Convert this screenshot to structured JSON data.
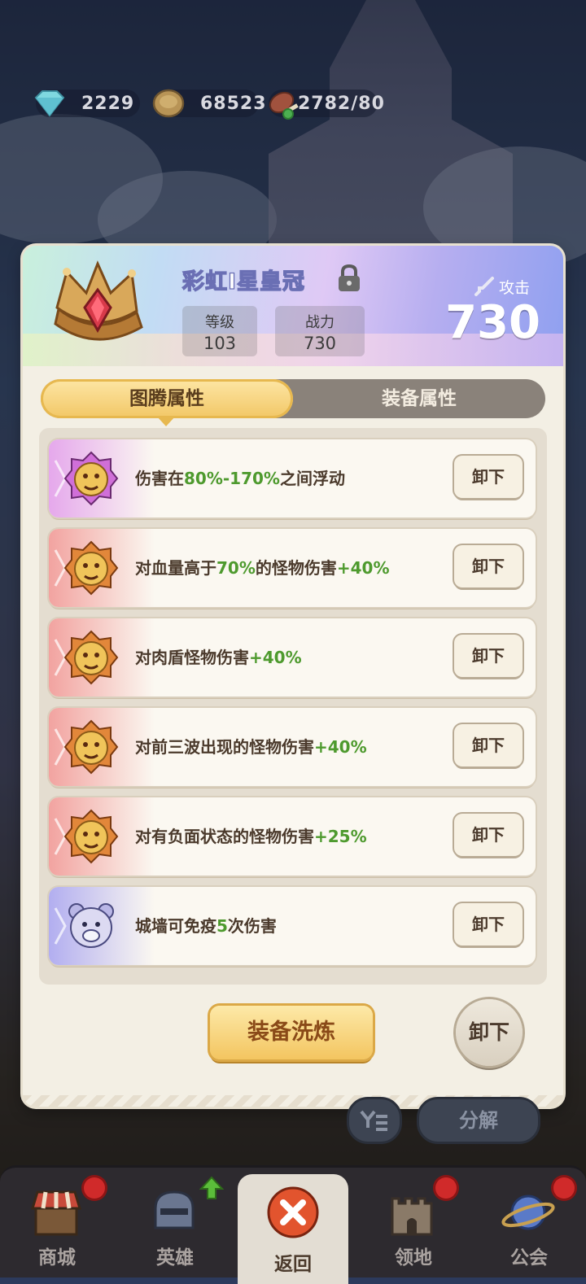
{
  "resources": [
    {
      "icon": "diamond-icon",
      "value": "2229"
    },
    {
      "icon": "coin-icon",
      "value": "68523"
    },
    {
      "icon": "meat-icon",
      "value": "2782/80"
    }
  ],
  "item": {
    "name": "彩虹I星皇冠",
    "level_label": "等级",
    "level": "103",
    "power_label": "战力",
    "power": "730",
    "attack_label": "攻击",
    "attack": "730"
  },
  "tabs": {
    "active": "图腾属性",
    "inactive": "装备属性"
  },
  "attributes": [
    {
      "tier": "purple",
      "prefix": "伤害在",
      "value": "80%-170%",
      "suffix": "之间浮动",
      "button": "卸下"
    },
    {
      "tier": "red",
      "prefix": "对血量高于",
      "value": "70%",
      "suffix": "的怪物伤害",
      "value2": "+40%",
      "button": "卸下"
    },
    {
      "tier": "red",
      "prefix": "对肉盾怪物伤害",
      "value": "+40%",
      "suffix": "",
      "button": "卸下"
    },
    {
      "tier": "red",
      "prefix": "对前三波出现的怪物伤害",
      "value": "+40%",
      "suffix": "",
      "button": "卸下"
    },
    {
      "tier": "red",
      "prefix": "对有负面状态的怪物伤害",
      "value": "+25%",
      "suffix": "",
      "button": "卸下"
    },
    {
      "tier": "blue",
      "prefix": "城墙可免疫",
      "value": "5",
      "suffix": "次伤害",
      "button": "卸下"
    }
  ],
  "actions": {
    "refine": "装备洗炼",
    "unequip": "卸下"
  },
  "under_panel": {
    "decompose": "分解"
  },
  "nav": [
    {
      "label": "商城",
      "icon": "shop-icon",
      "badge": true
    },
    {
      "label": "英雄",
      "icon": "helmet-icon",
      "badge": false,
      "upgrade_arrow": true
    },
    {
      "label": "返回",
      "icon": "close-icon",
      "badge": false,
      "active": true
    },
    {
      "label": "领地",
      "icon": "castle-icon",
      "badge": true
    },
    {
      "label": "公会",
      "icon": "planet-icon",
      "badge": true
    }
  ],
  "colors": {
    "highlight_green": "#4e9a2e",
    "tab_gold": "#f2c766",
    "badge_red": "#d02a2a"
  }
}
